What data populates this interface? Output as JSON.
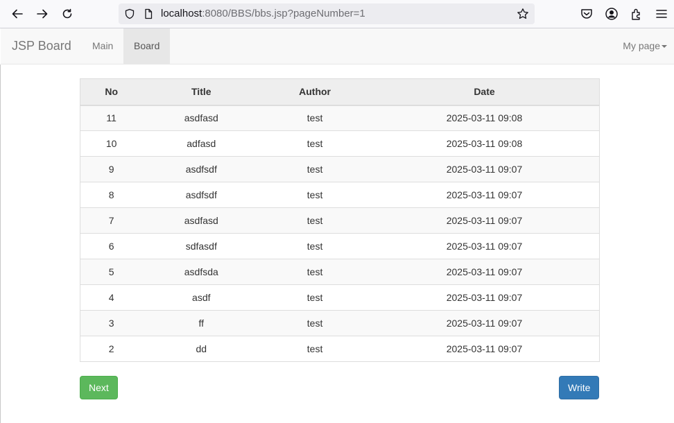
{
  "browser": {
    "url_host": "localhost",
    "url_rest": ":8080/BBS/bbs.jsp?pageNumber=1"
  },
  "navbar": {
    "brand": "JSP Board",
    "items": [
      {
        "label": "Main",
        "active": false
      },
      {
        "label": "Board",
        "active": true
      }
    ],
    "mypage_label": "My page"
  },
  "table": {
    "headers": {
      "no": "No",
      "title": "Title",
      "author": "Author",
      "date": "Date"
    },
    "rows": [
      {
        "no": "11",
        "title": "asdfasd",
        "author": "test",
        "date": "2025-03-11 09:08"
      },
      {
        "no": "10",
        "title": "adfasd",
        "author": "test",
        "date": "2025-03-11 09:08"
      },
      {
        "no": "9",
        "title": "asdfsdf",
        "author": "test",
        "date": "2025-03-11 09:07"
      },
      {
        "no": "8",
        "title": "asdfsdf",
        "author": "test",
        "date": "2025-03-11 09:07"
      },
      {
        "no": "7",
        "title": "asdfasd",
        "author": "test",
        "date": "2025-03-11 09:07"
      },
      {
        "no": "6",
        "title": "sdfasdf",
        "author": "test",
        "date": "2025-03-11 09:07"
      },
      {
        "no": "5",
        "title": "asdfsda",
        "author": "test",
        "date": "2025-03-11 09:07"
      },
      {
        "no": "4",
        "title": "asdf",
        "author": "test",
        "date": "2025-03-11 09:07"
      },
      {
        "no": "3",
        "title": "ff",
        "author": "test",
        "date": "2025-03-11 09:07"
      },
      {
        "no": "2",
        "title": "dd",
        "author": "test",
        "date": "2025-03-11 09:07"
      }
    ]
  },
  "buttons": {
    "next_label": "Next",
    "write_label": "Write"
  },
  "colors": {
    "next_button": "#5cb85c",
    "write_button": "#337ab7"
  }
}
